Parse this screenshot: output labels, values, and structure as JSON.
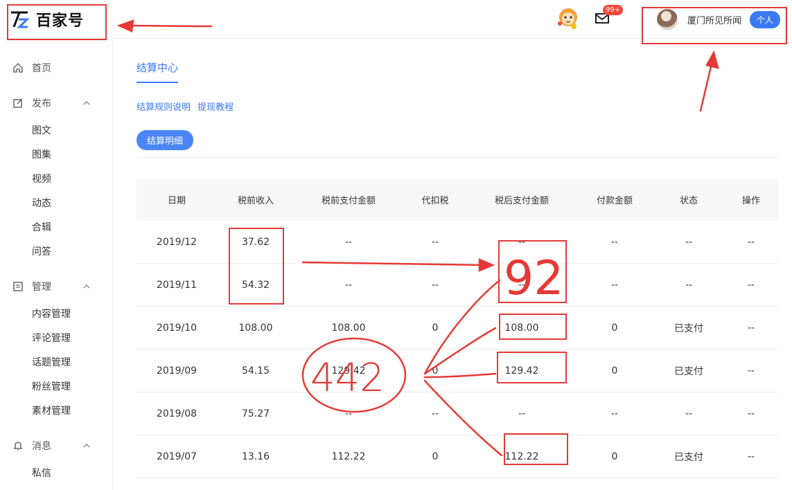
{
  "header": {
    "logo_text": "百家号",
    "notification_badge": "99+",
    "username": "厦门所见所闻",
    "role": "个人"
  },
  "sidebar": {
    "groups": [
      {
        "label": "首页",
        "icon": "home-icon"
      },
      {
        "label": "发布",
        "icon": "edit-icon",
        "items": [
          "图文",
          "图集",
          "视频",
          "动态",
          "合辑",
          "问答"
        ]
      },
      {
        "label": "管理",
        "icon": "document-icon",
        "items": [
          "内容管理",
          "评论管理",
          "话题管理",
          "粉丝管理",
          "素材管理"
        ]
      },
      {
        "label": "消息",
        "icon": "bell-icon",
        "items": [
          "私信"
        ]
      }
    ]
  },
  "main": {
    "tab": "结算中心",
    "links": [
      "结算规则说明",
      "提现教程"
    ],
    "detail_button": "结算明细",
    "table": {
      "headers": [
        "日期",
        "税前收入",
        "税前支付金额",
        "代扣税",
        "税后支付金额",
        "付款金额",
        "状态",
        "操作"
      ],
      "rows": [
        [
          "2019/12",
          "37.62",
          "--",
          "--",
          "--",
          "--",
          "--",
          "--"
        ],
        [
          "2019/11",
          "54.32",
          "--",
          "--",
          "--",
          "--",
          "--",
          "--"
        ],
        [
          "2019/10",
          "108.00",
          "108.00",
          "0",
          "108.00",
          "0",
          "已支付",
          "--"
        ],
        [
          "2019/09",
          "54.15",
          "129.42",
          "0",
          "129.42",
          "0",
          "已支付",
          "--"
        ],
        [
          "2019/08",
          "75.27",
          "--",
          "--",
          "--",
          "--",
          "--",
          "--"
        ],
        [
          "2019/07",
          "13.16",
          "112.22",
          "0",
          "112.22",
          "0",
          "已支付",
          "--"
        ]
      ]
    }
  },
  "annotations": {
    "handwritten_sum_a": "92",
    "handwritten_sum_b": "442",
    "color": "#e53935"
  },
  "colors": {
    "accent": "#3c7af5",
    "badge": "#f5483b",
    "annotation": "#e53935"
  }
}
